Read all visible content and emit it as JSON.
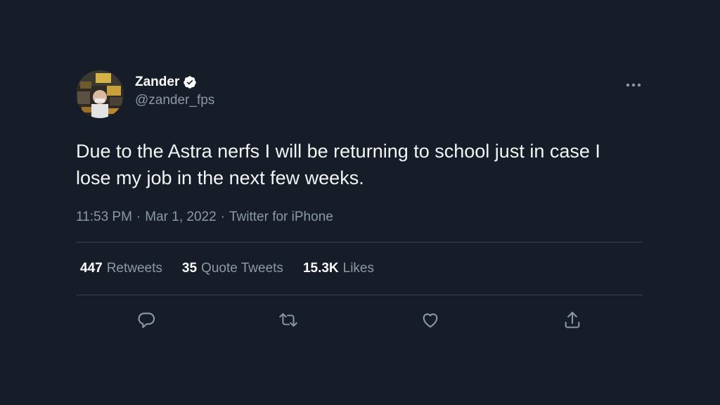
{
  "author": {
    "display_name": "Zander",
    "handle": "@zander_fps",
    "verified": true,
    "avatar_icon": "profile-photo"
  },
  "tweet": {
    "text": "Due to the Astra nerfs I will be returning to school just in case I lose my job in the next few weeks.",
    "time": "11:53 PM",
    "date": "Mar 1, 2022",
    "source": "Twitter for iPhone",
    "separator": "·"
  },
  "stats": {
    "retweets_count": "447",
    "retweets_label": "Retweets",
    "quotes_count": "35",
    "quotes_label": "Quote Tweets",
    "likes_count": "15.3K",
    "likes_label": "Likes"
  },
  "actions": [
    "reply-icon",
    "retweet-icon",
    "like-icon",
    "share-icon"
  ],
  "colors": {
    "background": "#171d28",
    "text": "#e7e9ea",
    "muted": "#8b98a5",
    "divider": "#38444d"
  }
}
